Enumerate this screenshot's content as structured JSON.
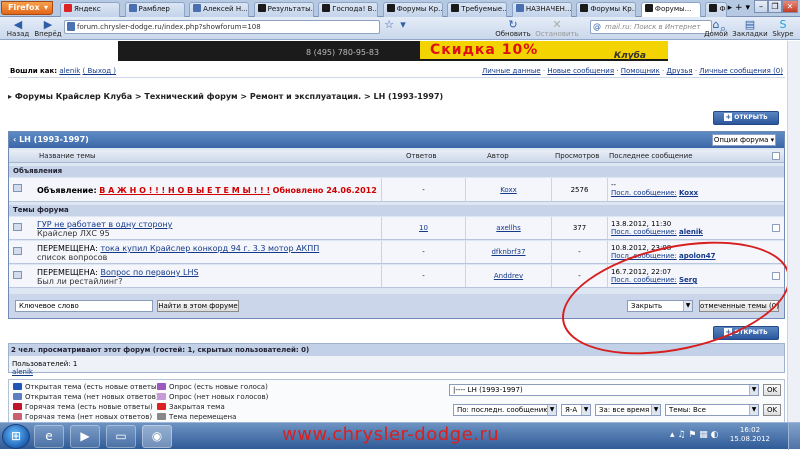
{
  "browser": {
    "menu_label": "Firefox",
    "tabs": [
      {
        "label": "Яндекс"
      },
      {
        "label": "Рамблер"
      },
      {
        "label": "Алексей Н..."
      },
      {
        "label": "Результаты..."
      },
      {
        "label": "Господа! В..."
      },
      {
        "label": "Форумы Кр..."
      },
      {
        "label": "Требуемые..."
      },
      {
        "label": "НАЗНАЧЕН..."
      },
      {
        "label": "Форумы Кр..."
      },
      {
        "label": "Форумы..."
      },
      {
        "label": "Фо"
      }
    ],
    "nav": {
      "back": "Назад",
      "forward": "Вперёд",
      "refresh": "Обновить",
      "stop": "Остановить",
      "home": "Домой",
      "bookmarks": "Закладки",
      "skype": "Skype"
    },
    "url": "forum.chrysler-dodge.ru/index.php?showforum=108",
    "search_placeholder": "mail.ru: Поиск в Интернет"
  },
  "page": {
    "banner": {
      "phone": "8 (495) 780-95-83",
      "sale": "Скидка 10%",
      "club": "Клуба"
    },
    "userbar": {
      "prefix": "Вошли как:",
      "user": "alenik",
      "logout": "( Выход )",
      "links": [
        "Личные данные",
        "Новые сообщения",
        "Помощник",
        "Друзья",
        "Личные сообщения (0)"
      ]
    },
    "breadcrumb": "Форумы Крайслер Клуба > Технический форум > Ремонт и эксплуатация. > LH (1993-1997)",
    "open_topic_label": "ОТКРЫТЬ ТЕМУ",
    "forum": {
      "title": "‹ LH (1993-1997)",
      "options_label": "Опции форума ▾",
      "columns": [
        "Название темы",
        "Ответов",
        "Автор",
        "Просмотров",
        "Последнее сообщение"
      ],
      "announce_section": "Объявления",
      "announcement": {
        "prefix": "Объявление:",
        "title": "В А Ж Н О ! ! !   Н О В Ы Е   Т Е М Ы ! ! !",
        "updated": "Обновлено 24.06.2012",
        "replies": "-",
        "author": "Koxx",
        "views": "2576",
        "last_date": "--",
        "last_label": "Посл. сообщение:",
        "last_user": "Koxx"
      },
      "topics_section": "Темы форума",
      "topics": [
        {
          "prefix": "",
          "title": "ГУР не работает в одну сторону",
          "subtitle": "Крайслер ЛХС 95",
          "replies": "10",
          "author": "axellhs",
          "views": "377",
          "last_date": "13.8.2012, 11:30",
          "last_label": "Посл. сообщение:",
          "last_user": "alenik"
        },
        {
          "prefix": "ПЕРЕМЕЩЕНА:",
          "title": "тока купил Крайслер конкорд 94 г. 3.3 мотор АКПП",
          "subtitle": "список вопросов",
          "replies": "-",
          "author": "dfknbrf37",
          "views": "-",
          "last_date": "10.8.2012, 23:08",
          "last_label": "Посл. сообщение:",
          "last_user": "apolon47"
        },
        {
          "prefix": "ПЕРЕМЕЩЕНА:",
          "title": "Вопрос по первону LHS",
          "subtitle": "Был ли рестайлинг?",
          "replies": "-",
          "author": "Anddrev",
          "views": "-",
          "last_date": "16.7.2012, 22:07",
          "last_label": "Посл. сообщение:",
          "last_user": "Serg"
        }
      ],
      "search_placeholder": "Ключевое слово",
      "search_button": "Найти в этом форуме",
      "close_select": "Закрыть",
      "marked_button": "отмеченные темы (0)"
    },
    "viewers": {
      "heading": "2 чел. просматривают этот форум (гостей: 1, скрытых пользователей: 0)",
      "members_label": "Пользователей: 1",
      "member": "alenik"
    },
    "legend": {
      "items": [
        {
          "label": "Открытая тема (есть новые ответы)",
          "color": "#1f55b4"
        },
        {
          "label": "Открытая тема (нет новых ответов)",
          "color": "#5b7fc0"
        },
        {
          "label": "Горячая тема (есть новые ответы)",
          "color": "#c0142b"
        },
        {
          "label": "Горячая тема (нет новых ответов)",
          "color": "#c9606f"
        },
        {
          "label": "Опрос (есть новые голоса)",
          "color": "#9d57bf"
        },
        {
          "label": "Опрос (нет новых голосов)",
          "color": "#c79ad9"
        },
        {
          "label": "Закрытая тема",
          "color": "#d22"
        },
        {
          "label": "Тема перемещена",
          "color": "#888"
        }
      ],
      "jump_select": "|---- LH (1993-1997)",
      "sort_by": "По: последн. сообщению",
      "sort_order": "Я-А",
      "period": "За: все время",
      "topics_filter": "Темы: Все",
      "ok": "OK"
    }
  },
  "taskbar": {
    "watermark": "www.chrysler-dodge.ru",
    "time": "16:02",
    "date": "15.08.2012"
  },
  "colors": {
    "accent": "#3b67a8",
    "annotation": "#d61f1f",
    "banner_yellow": "#f4d400"
  }
}
